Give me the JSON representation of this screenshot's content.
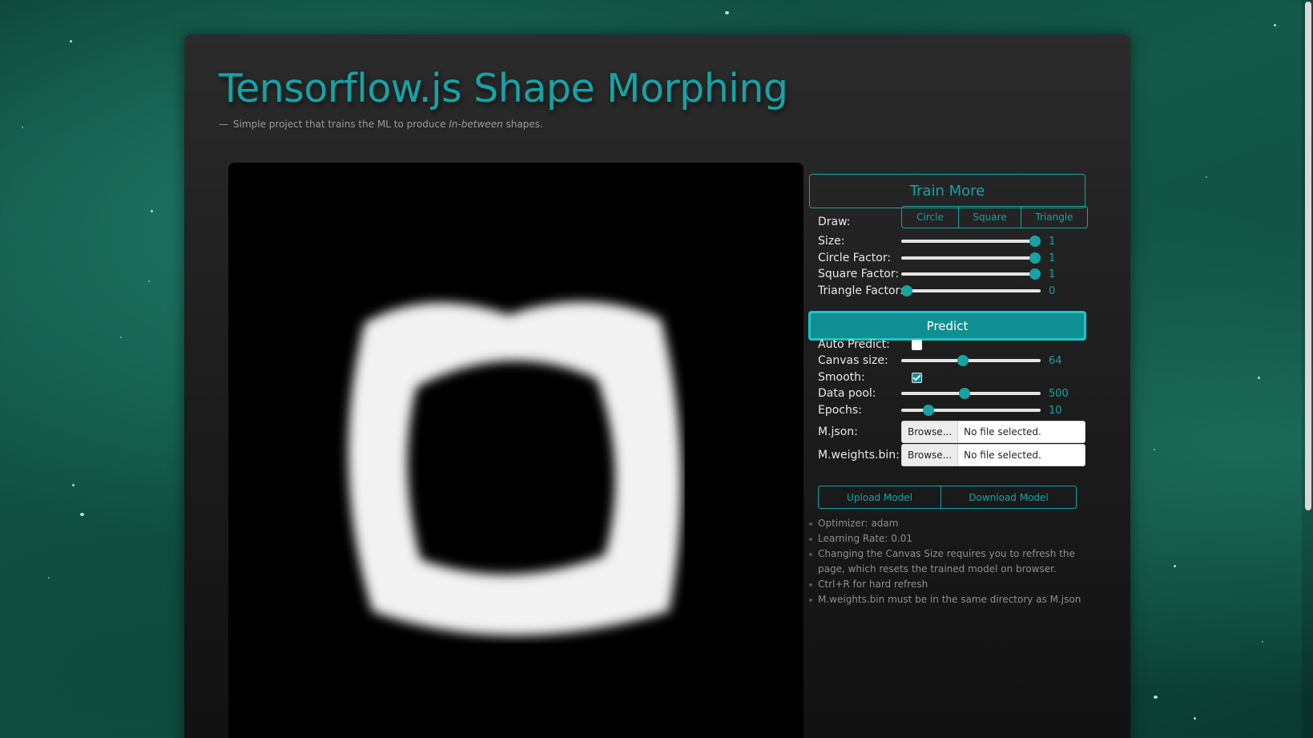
{
  "header": {
    "title": "Tensorflow.js Shape Morphing",
    "subtitle_dash": "—",
    "subtitle_pre": "Simple project that trains the ML to produce ",
    "subtitle_em": "In-between",
    "subtitle_post": " shapes."
  },
  "controls": {
    "train_label": "Train More",
    "draw_label": "Draw:",
    "draw_options": [
      "Circle",
      "Square",
      "Triangle"
    ],
    "size": {
      "label": "Size:",
      "value": "1",
      "fraction": 1.0
    },
    "circle_factor": {
      "label": "Circle Factor:",
      "value": "1",
      "fraction": 1.0
    },
    "square_factor": {
      "label": "Square Factor:",
      "value": "1",
      "fraction": 1.0
    },
    "triangle_factor": {
      "label": "Triangle Factor:",
      "value": "0",
      "fraction": 0.0
    },
    "predict_label": "Predict",
    "auto_predict": {
      "label": "Auto Predict:",
      "checked": false
    },
    "canvas_size": {
      "label": "Canvas size:",
      "value": "64",
      "fraction": 0.44
    },
    "smooth": {
      "label": "Smooth:",
      "checked": true
    },
    "data_pool": {
      "label": "Data pool:",
      "value": "500",
      "fraction": 0.45
    },
    "epochs": {
      "label": "Epochs:",
      "value": "10",
      "fraction": 0.17
    },
    "m_json": {
      "label": "M.json:",
      "button": "Browse...",
      "file": "No file selected."
    },
    "m_weights": {
      "label": "M.weights.bin:",
      "button": "Browse...",
      "file": "No file selected."
    },
    "upload_label": "Upload Model",
    "download_label": "Download Model",
    "notes": [
      "Optimizer: adam",
      "Learning Rate: 0.01",
      "Changing the Canvas Size requires you to refresh the page, which resets the trained model on browser.",
      "Ctrl+R for hard refresh",
      "M.weights.bin must be in the same directory as M.json"
    ]
  },
  "theme": {
    "accent": "#16a3a6",
    "panel": "#1f1f1f",
    "canvas": "#000000"
  }
}
